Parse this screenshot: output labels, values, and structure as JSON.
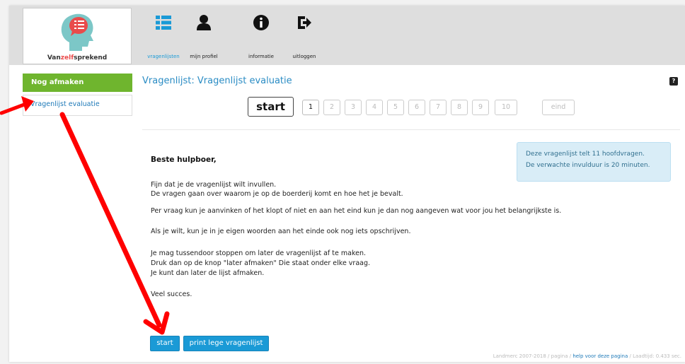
{
  "header": {
    "logo": {
      "prefix": "Van",
      "highlight": "zelf",
      "suffix": "sprekend"
    },
    "nav": [
      {
        "label": "vragenlijsten",
        "icon": "list-icon",
        "active": true
      },
      {
        "label": "mijn profiel",
        "icon": "user-icon",
        "active": false
      },
      {
        "label": "informatie",
        "icon": "info-icon",
        "active": false
      },
      {
        "label": "uitloggen",
        "icon": "logout-icon",
        "active": false
      }
    ]
  },
  "sidebar": {
    "section": "Nog afmaken",
    "items": [
      {
        "label": "Vragenlijst evaluatie"
      }
    ]
  },
  "main": {
    "title": "Vragenlijst: Vragenlijst evaluatie",
    "help": "?",
    "steps": {
      "start": "start",
      "numbers": [
        "1",
        "2",
        "3",
        "4",
        "5",
        "6",
        "7",
        "8",
        "9",
        "10"
      ],
      "end": "eind",
      "current": "1"
    },
    "info": {
      "line1": "Deze vragenlijst telt 11 hoofdvragen.",
      "line2": "De verwachte invulduur is 20 minuten."
    },
    "greeting": "Beste hulpboer,",
    "paragraphs": [
      "Fijn dat je de vragenlijst wilt invullen.",
      "De vragen gaan over waarom je op de boerderij komt en hoe het je bevalt.",
      "Per vraag kun je aanvinken of het klopt of niet en aan het eind kun je dan nog aangeven wat voor jou het belangrijkste is.",
      "Als je wilt, kun je in je eigen woorden aan het einde ook nog iets opschrijven.",
      "Je mag tussendoor stoppen om later de vragenlijst af te maken.",
      "Druk dan op de knop \"later afmaken\"  Die staat onder elke vraag.",
      "Je kunt dan later de lijst afmaken.",
      "Veel succes."
    ],
    "buttons": {
      "start": "start",
      "print": "print lege vragenlijst"
    }
  },
  "footer": {
    "copyright": "Landmerc 2007-2018 / pagina /",
    "help_link": "help voor deze pagina",
    "timing": "/ Laadtijd: 0.433 sec."
  },
  "colors": {
    "accent": "#1a9ad6",
    "sidebar_active": "#6fb52e",
    "info_bg": "#d9edf7",
    "annotation": "#ff0000"
  }
}
